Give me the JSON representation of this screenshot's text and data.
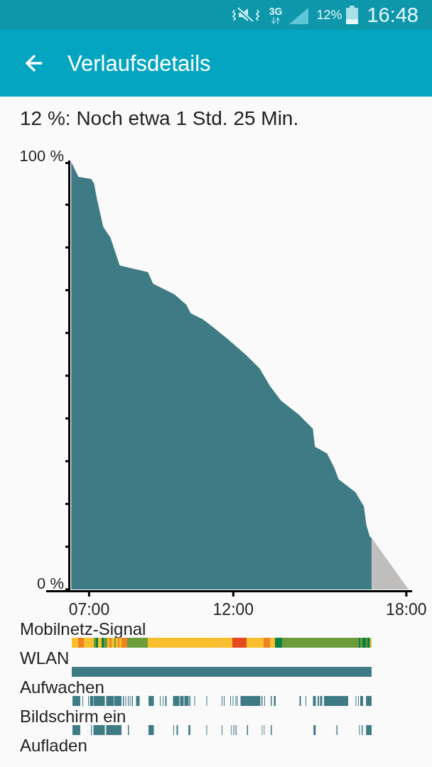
{
  "status_bar": {
    "network_type": "3G",
    "battery_percent": "12%",
    "time": "16:48"
  },
  "app_bar": {
    "title": "Verlaufsdetails"
  },
  "summary": "12 %: Noch etwa 1 Std. 25 Min.",
  "battery_chart": {
    "chart_data": {
      "type": "area",
      "x": [
        6.38,
        6.63,
        7.07,
        7.17,
        7.27,
        7.49,
        7.74,
        8.06,
        9.04,
        9.22,
        9.96,
        10.37,
        10.52,
        10.94,
        11.31,
        11.8,
        12.42,
        12.91,
        13.28,
        13.65,
        14.27,
        14.76,
        14.83,
        15.25,
        15.5,
        15.65,
        16.24,
        16.53,
        16.61,
        16.73,
        16.8,
        18.08
      ],
      "series": [
        {
          "color": "#3e7b85",
          "values": [
            100,
            96.5,
            96,
            95,
            91.4,
            84.8,
            82.3,
            75.8,
            74.2,
            71.5,
            69,
            66.6,
            64.6,
            63.2,
            61.3,
            58.6,
            55,
            51.7,
            47.5,
            44.2,
            40.9,
            37.6,
            33.4,
            31.8,
            28.5,
            25.8,
            22.7,
            19.4,
            15.2,
            12.4,
            12,
            null
          ]
        },
        {
          "color": "#bfbebc",
          "values": [
            null,
            null,
            null,
            null,
            null,
            null,
            null,
            null,
            null,
            null,
            null,
            null,
            null,
            null,
            null,
            null,
            null,
            null,
            null,
            null,
            null,
            null,
            null,
            null,
            null,
            null,
            null,
            null,
            null,
            null,
            12,
            0
          ]
        }
      ],
      "xlim": [
        6.3,
        18.2
      ],
      "ylim": [
        0,
        100
      ],
      "xticks": [
        {
          "value": 7,
          "label": "07:00"
        },
        {
          "value": 12,
          "label": "12:00"
        },
        {
          "value": 18,
          "label": "18:00"
        }
      ],
      "yticks": [
        {
          "value": 0,
          "label": "0 %"
        },
        {
          "value": 100,
          "label": "100 %"
        }
      ]
    }
  },
  "timelines": [
    {
      "label": "Mobilnetz-Signal",
      "kind": "signal"
    },
    {
      "label": "WLAN",
      "kind": "wifi"
    },
    {
      "label": "Aufwachen",
      "kind": "wake"
    },
    {
      "label": "Bildschirm ein",
      "kind": "screen"
    },
    {
      "label": "Aufladen",
      "kind": "charging"
    }
  ]
}
